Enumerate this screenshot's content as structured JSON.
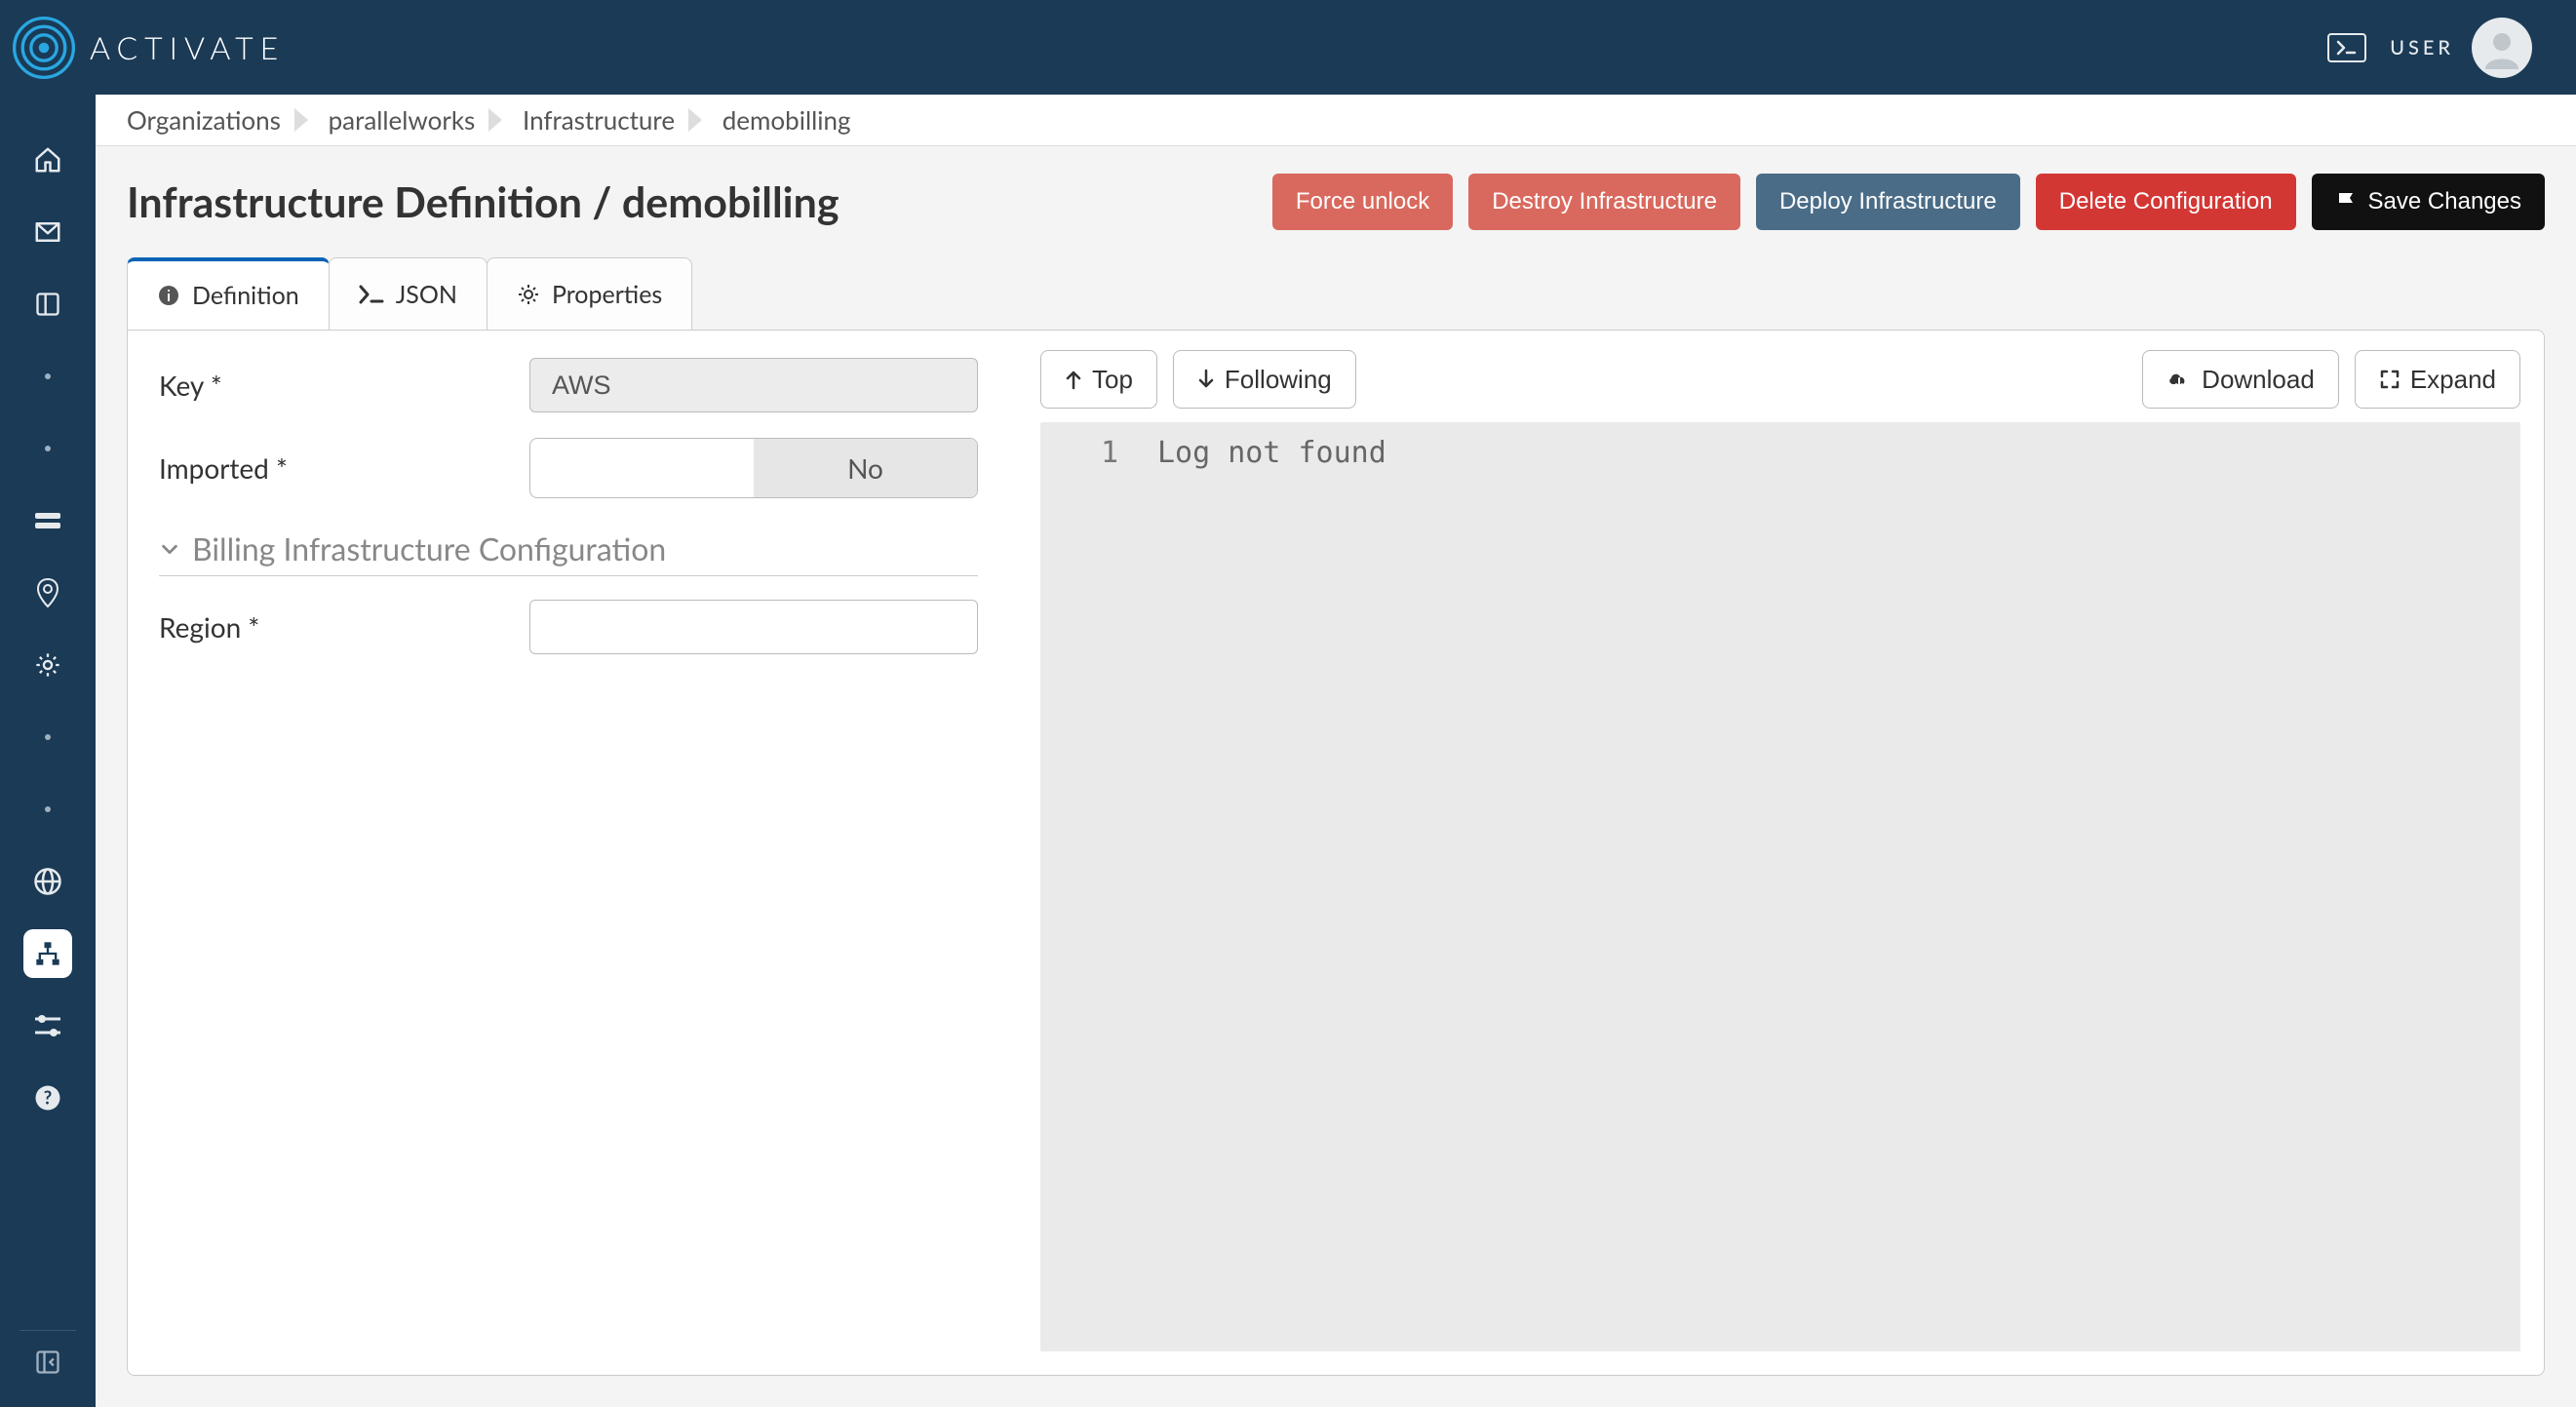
{
  "header": {
    "brand": "ACTIVATE",
    "user_label": "USER"
  },
  "breadcrumb": [
    "Organizations",
    "parallelworks",
    "Infrastructure",
    "demobilling"
  ],
  "page": {
    "title": "Infrastructure Definition / demobilling"
  },
  "actions": {
    "force_unlock": "Force unlock",
    "destroy": "Destroy Infrastructure",
    "deploy": "Deploy Infrastructure",
    "delete": "Delete Configuration",
    "save": "Save Changes"
  },
  "tabs": {
    "definition": "Definition",
    "json": "JSON",
    "properties": "Properties"
  },
  "form": {
    "key_label": "Key *",
    "key_value": "AWS",
    "imported_label": "Imported *",
    "imported_value": "No",
    "section_title": "Billing Infrastructure Configuration",
    "region_label": "Region *",
    "region_value": ""
  },
  "log": {
    "top": "Top",
    "following": "Following",
    "download": "Download",
    "expand": "Expand",
    "lines": [
      {
        "n": "1",
        "text": "Log not found"
      }
    ]
  }
}
